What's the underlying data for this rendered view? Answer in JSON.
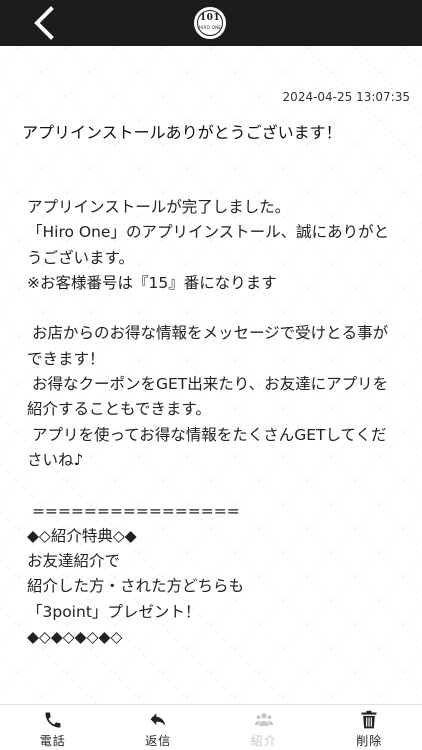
{
  "header": {
    "back_icon": "chevron-left-icon",
    "logo_number": "101",
    "logo_text": "HIRO ONE"
  },
  "message": {
    "date": "2024-04-25 13:07:35",
    "title": "アプリインストールありがとうございます！",
    "body": "アプリインストールが完了しました。\n「Hiro One」のアプリインストール、誠にありがとうございます。\n※お客様番号は『15』番になります\n\n お店からのお得な情報をメッセージで受けとる事ができます！\n お得なクーポンをGET出来たり、お友達にアプリを紹介することもできます。\n アプリを使ってお得な情報をたくさんGETしてくださいね♪\n\n ================\n◆◇紹介特典◇◆\nお友達紹介で\n紹介した方・された方どちらも\n「3point」プレゼント！\n◆◇◆◇◆◇◆◇"
  },
  "tabbar": {
    "tabs": [
      {
        "label": "電話",
        "icon": "phone-icon",
        "enabled": true
      },
      {
        "label": "返信",
        "icon": "reply-icon",
        "enabled": true
      },
      {
        "label": "紹介",
        "icon": "group-icon",
        "enabled": false
      },
      {
        "label": "削除",
        "icon": "trash-icon",
        "enabled": true
      }
    ]
  },
  "colors": {
    "header_bg": "#1c1c1c",
    "disabled_text": "#c6c6c6"
  }
}
